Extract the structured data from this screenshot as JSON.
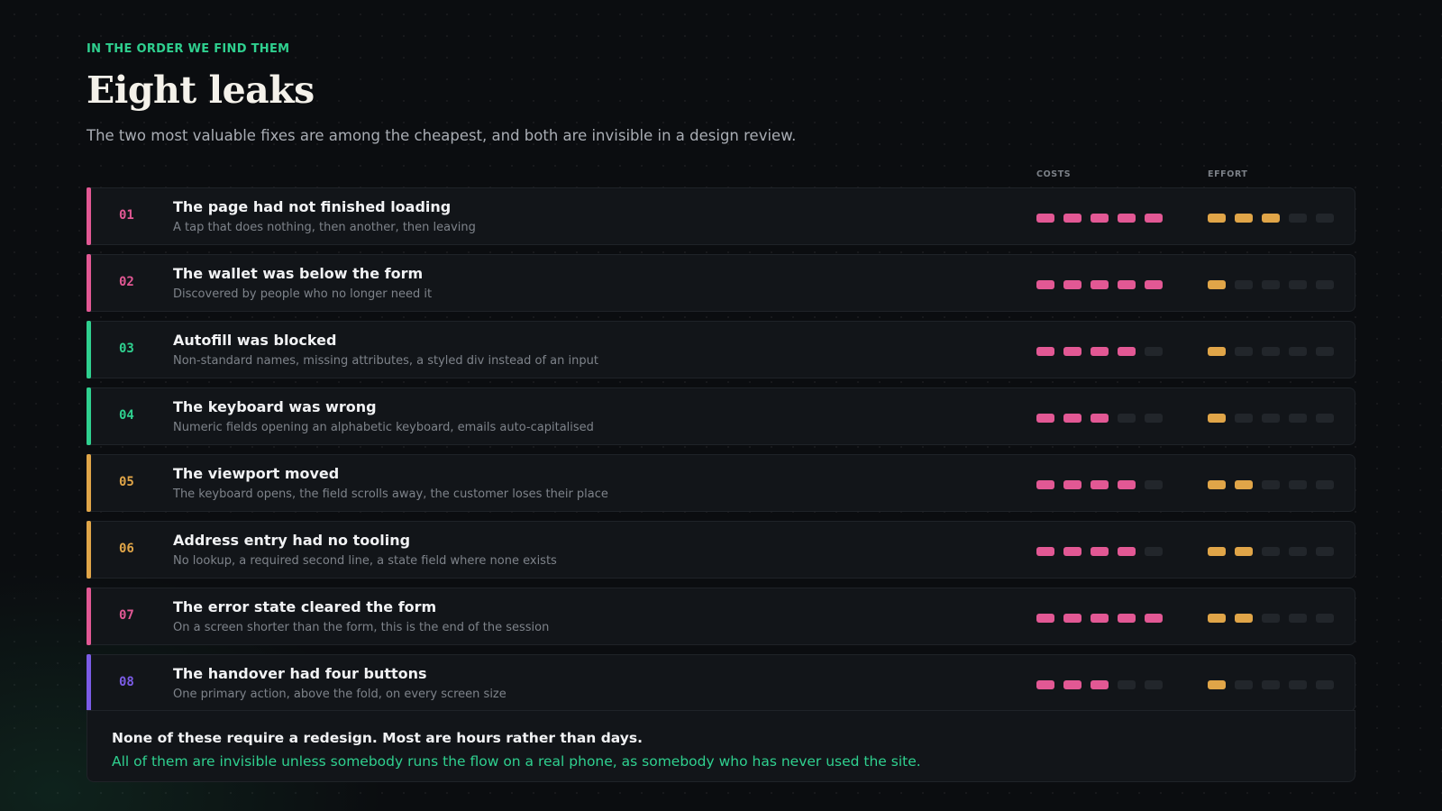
{
  "header": {
    "eyebrow": "IN THE ORDER WE FIND THEM",
    "title": "Eight leaks",
    "subtitle": "The two most valuable fixes are among the cheapest, and both are invisible in a design review."
  },
  "columns": {
    "costs": "COSTS",
    "effort": "EFFORT",
    "max_level": 5
  },
  "colors": {
    "pink": "#e25894",
    "green": "#2fd08f",
    "amber": "#e0a548",
    "violet": "#7b5ce6",
    "costs_bar": "#e25894",
    "effort_bar": "#e0a548",
    "bar_off": "#22262b"
  },
  "leaks": [
    {
      "num": "01",
      "title": "The page had not finished loading",
      "desc": "A tap that does nothing, then another, then leaving",
      "accent": "#e25894",
      "costs": 5,
      "effort": 3
    },
    {
      "num": "02",
      "title": "The wallet was below the form",
      "desc": "Discovered by people who no longer need it",
      "accent": "#e25894",
      "costs": 5,
      "effort": 1
    },
    {
      "num": "03",
      "title": "Autofill was blocked",
      "desc": "Non-standard names, missing attributes, a styled div instead of an input",
      "accent": "#2fd08f",
      "costs": 4,
      "effort": 1
    },
    {
      "num": "04",
      "title": "The keyboard was wrong",
      "desc": "Numeric fields opening an alphabetic keyboard, emails auto-capitalised",
      "accent": "#2fd08f",
      "costs": 3,
      "effort": 1
    },
    {
      "num": "05",
      "title": "The viewport moved",
      "desc": "The keyboard opens, the field scrolls away, the customer loses their place",
      "accent": "#e0a548",
      "costs": 4,
      "effort": 2
    },
    {
      "num": "06",
      "title": "Address entry had no tooling",
      "desc": "No lookup, a required second line, a state field where none exists",
      "accent": "#e0a548",
      "costs": 4,
      "effort": 2
    },
    {
      "num": "07",
      "title": "The error state cleared the form",
      "desc": "On a screen shorter than the form, this is the end of the session",
      "accent": "#e25894",
      "costs": 5,
      "effort": 2
    },
    {
      "num": "08",
      "title": "The handover had four buttons",
      "desc": "One primary action, above the fold, on every screen size",
      "accent": "#7b5ce6",
      "costs": 3,
      "effort": 1
    }
  ],
  "footer": {
    "line1": "None of these require a redesign. Most are hours rather than days.",
    "line2": "All of them are invisible unless somebody runs the flow on a real phone, as somebody who has never used the site."
  }
}
